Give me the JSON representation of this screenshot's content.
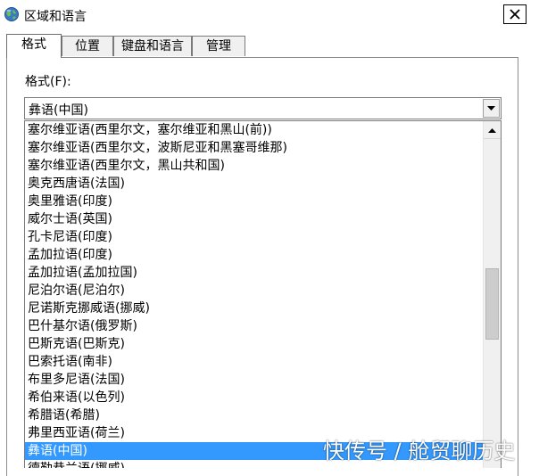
{
  "window": {
    "title": "区域和语言",
    "close_glyph": "✕"
  },
  "tabs": [
    {
      "label": "格式",
      "active": true
    },
    {
      "label": "位置",
      "active": false
    },
    {
      "label": "键盘和语言",
      "active": false
    },
    {
      "label": "管理",
      "active": false
    }
  ],
  "format": {
    "label": "格式(F):",
    "selected": "彝语(中国)",
    "options": [
      "塞尔维亚语(西里尔文，塞尔维亚和黑山(前))",
      "塞尔维亚语(西里尔文，波斯尼亚和黑塞哥维那)",
      "塞尔维亚语(西里尔文，黑山共和国)",
      "奥克西唐语(法国)",
      "奥里雅语(印度)",
      "威尔士语(英国)",
      "孔卡尼语(印度)",
      "孟加拉语(印度)",
      "孟加拉语(孟加拉国)",
      "尼泊尔语(尼泊尔)",
      "尼诺斯克挪威语(挪威)",
      "巴什基尔语(俄罗斯)",
      "巴斯克语(巴斯克)",
      "巴索托语(南非)",
      "布里多尼语(法国)",
      "希伯来语(以色列)",
      "希腊语(希腊)",
      "弗里西亚语(荷兰)",
      "彝语(中国)",
      "德勒恭兰语(挪威)"
    ],
    "selected_index": 18
  },
  "watermark": {
    "text": "快传号 / 舱贸聊历史"
  },
  "colors": {
    "selection": "#3399ff",
    "tab_inactive": "#f0f0f0"
  }
}
